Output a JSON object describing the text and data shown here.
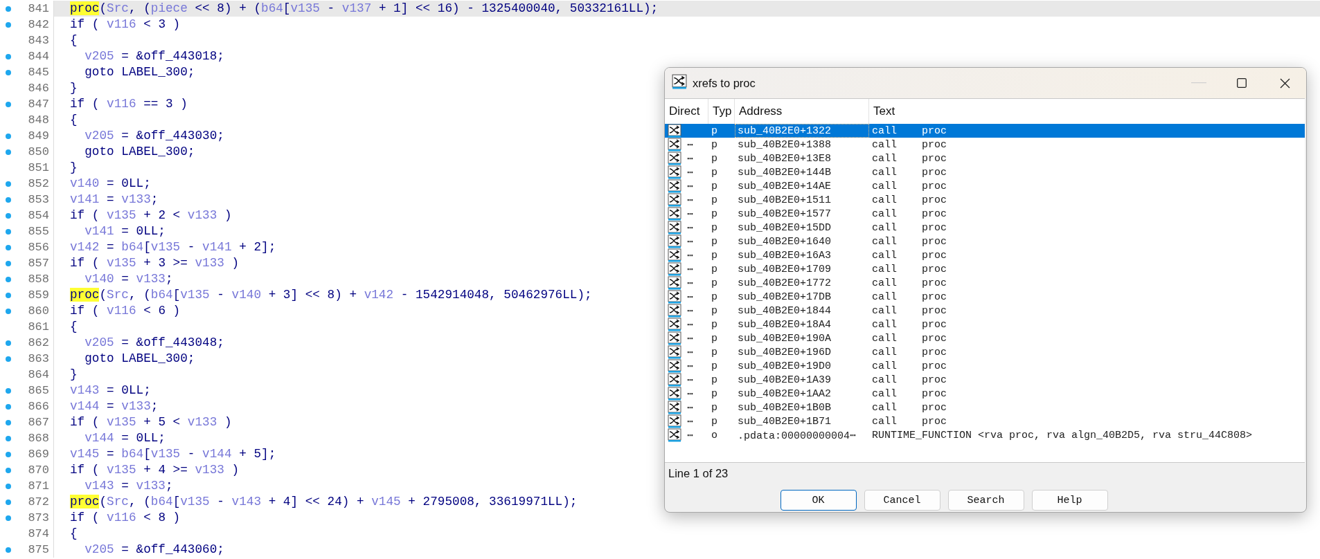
{
  "code": {
    "lines": [
      {
        "number": "841",
        "dot": true,
        "current": true,
        "tokens": [
          {
            "kind": "hit",
            "text": "proc"
          },
          "(",
          {
            "kind": "var",
            "text": "Src"
          },
          ", (",
          {
            "kind": "var",
            "text": "piece"
          },
          " << 8) + (",
          {
            "kind": "var",
            "text": "b64"
          },
          "[",
          {
            "kind": "var",
            "text": "v135"
          },
          " - ",
          {
            "kind": "var",
            "text": "v137"
          },
          " + 1] << 16) - 1325400040, 50332161LL);"
        ]
      },
      {
        "number": "842",
        "dot": true,
        "current": false,
        "tokens": [
          "if ( ",
          {
            "kind": "var",
            "text": "v116"
          },
          " < 3 )"
        ]
      },
      {
        "number": "843",
        "dot": false,
        "current": false,
        "tokens": [
          "{"
        ]
      },
      {
        "number": "844",
        "dot": true,
        "current": false,
        "tokens": [
          {
            "kind": "var",
            "text": "  v205"
          },
          " = &off_443018;"
        ]
      },
      {
        "number": "845",
        "dot": true,
        "current": false,
        "tokens": [
          "  goto LABEL_300;"
        ]
      },
      {
        "number": "846",
        "dot": false,
        "current": false,
        "tokens": [
          "}"
        ]
      },
      {
        "number": "847",
        "dot": true,
        "current": false,
        "tokens": [
          "if ( ",
          {
            "kind": "var",
            "text": "v116"
          },
          " == 3 )"
        ]
      },
      {
        "number": "848",
        "dot": false,
        "current": false,
        "tokens": [
          "{"
        ]
      },
      {
        "number": "849",
        "dot": true,
        "current": false,
        "tokens": [
          {
            "kind": "var",
            "text": "  v205"
          },
          " = &off_443030;"
        ]
      },
      {
        "number": "850",
        "dot": true,
        "current": false,
        "tokens": [
          "  goto LABEL_300;"
        ]
      },
      {
        "number": "851",
        "dot": false,
        "current": false,
        "tokens": [
          "}"
        ]
      },
      {
        "number": "852",
        "dot": true,
        "current": false,
        "tokens": [
          {
            "kind": "var",
            "text": "v140"
          },
          " = 0LL;"
        ]
      },
      {
        "number": "853",
        "dot": true,
        "current": false,
        "tokens": [
          {
            "kind": "var",
            "text": "v141"
          },
          " = ",
          {
            "kind": "var",
            "text": "v133"
          },
          ";"
        ]
      },
      {
        "number": "854",
        "dot": true,
        "current": false,
        "tokens": [
          "if ( ",
          {
            "kind": "var",
            "text": "v135"
          },
          " + 2 < ",
          {
            "kind": "var",
            "text": "v133"
          },
          " )"
        ]
      },
      {
        "number": "855",
        "dot": true,
        "current": false,
        "tokens": [
          {
            "kind": "var",
            "text": "  v141"
          },
          " = 0LL;"
        ]
      },
      {
        "number": "856",
        "dot": true,
        "current": false,
        "tokens": [
          {
            "kind": "var",
            "text": "v142"
          },
          " = ",
          {
            "kind": "var",
            "text": "b64"
          },
          "[",
          {
            "kind": "var",
            "text": "v135"
          },
          " - ",
          {
            "kind": "var",
            "text": "v141"
          },
          " + 2];"
        ]
      },
      {
        "number": "857",
        "dot": true,
        "current": false,
        "tokens": [
          "if ( ",
          {
            "kind": "var",
            "text": "v135"
          },
          " + 3 >= ",
          {
            "kind": "var",
            "text": "v133"
          },
          " )"
        ]
      },
      {
        "number": "858",
        "dot": true,
        "current": false,
        "tokens": [
          {
            "kind": "var",
            "text": "  v140"
          },
          " = ",
          {
            "kind": "var",
            "text": "v133"
          },
          ";"
        ]
      },
      {
        "number": "859",
        "dot": true,
        "current": false,
        "tokens": [
          {
            "kind": "hit",
            "text": "proc"
          },
          "(",
          {
            "kind": "var",
            "text": "Src"
          },
          ", (",
          {
            "kind": "var",
            "text": "b64"
          },
          "[",
          {
            "kind": "var",
            "text": "v135"
          },
          " - ",
          {
            "kind": "var",
            "text": "v140"
          },
          " + 3] << 8) + ",
          {
            "kind": "var",
            "text": "v142"
          },
          " - 1542914048, 50462976LL);"
        ]
      },
      {
        "number": "860",
        "dot": true,
        "current": false,
        "tokens": [
          "if ( ",
          {
            "kind": "var",
            "text": "v116"
          },
          " < 6 )"
        ]
      },
      {
        "number": "861",
        "dot": false,
        "current": false,
        "tokens": [
          "{"
        ]
      },
      {
        "number": "862",
        "dot": true,
        "current": false,
        "tokens": [
          {
            "kind": "var",
            "text": "  v205"
          },
          " = &off_443048;"
        ]
      },
      {
        "number": "863",
        "dot": true,
        "current": false,
        "tokens": [
          "  goto LABEL_300;"
        ]
      },
      {
        "number": "864",
        "dot": false,
        "current": false,
        "tokens": [
          "}"
        ]
      },
      {
        "number": "865",
        "dot": true,
        "current": false,
        "tokens": [
          {
            "kind": "var",
            "text": "v143"
          },
          " = 0LL;"
        ]
      },
      {
        "number": "866",
        "dot": true,
        "current": false,
        "tokens": [
          {
            "kind": "var",
            "text": "v144"
          },
          " = ",
          {
            "kind": "var",
            "text": "v133"
          },
          ";"
        ]
      },
      {
        "number": "867",
        "dot": true,
        "current": false,
        "tokens": [
          "if ( ",
          {
            "kind": "var",
            "text": "v135"
          },
          " + 5 < ",
          {
            "kind": "var",
            "text": "v133"
          },
          " )"
        ]
      },
      {
        "number": "868",
        "dot": true,
        "current": false,
        "tokens": [
          {
            "kind": "var",
            "text": "  v144"
          },
          " = 0LL;"
        ]
      },
      {
        "number": "869",
        "dot": true,
        "current": false,
        "tokens": [
          {
            "kind": "var",
            "text": "v145"
          },
          " = ",
          {
            "kind": "var",
            "text": "b64"
          },
          "[",
          {
            "kind": "var",
            "text": "v135"
          },
          " - ",
          {
            "kind": "var",
            "text": "v144"
          },
          " + 5];"
        ]
      },
      {
        "number": "870",
        "dot": true,
        "current": false,
        "tokens": [
          "if ( ",
          {
            "kind": "var",
            "text": "v135"
          },
          " + 4 >= ",
          {
            "kind": "var",
            "text": "v133"
          },
          " )"
        ]
      },
      {
        "number": "871",
        "dot": true,
        "current": false,
        "tokens": [
          {
            "kind": "var",
            "text": "  v143"
          },
          " = ",
          {
            "kind": "var",
            "text": "v133"
          },
          ";"
        ]
      },
      {
        "number": "872",
        "dot": true,
        "current": false,
        "tokens": [
          {
            "kind": "hit",
            "text": "proc"
          },
          "(",
          {
            "kind": "var",
            "text": "Src"
          },
          ", (",
          {
            "kind": "var",
            "text": "b64"
          },
          "[",
          {
            "kind": "var",
            "text": "v135"
          },
          " - ",
          {
            "kind": "var",
            "text": "v143"
          },
          " + 4] << 24) + ",
          {
            "kind": "var",
            "text": "v145"
          },
          " + 2795008, 33619971LL);"
        ]
      },
      {
        "number": "873",
        "dot": true,
        "current": false,
        "tokens": [
          "if ( ",
          {
            "kind": "var",
            "text": "v116"
          },
          " < 8 )"
        ]
      },
      {
        "number": "874",
        "dot": false,
        "current": false,
        "tokens": [
          "{"
        ]
      },
      {
        "number": "875",
        "dot": true,
        "current": false,
        "tokens": [
          {
            "kind": "var",
            "text": "  v205"
          },
          " = &off_443060;"
        ]
      }
    ]
  },
  "dialog": {
    "title": "xrefs to proc",
    "columns": [
      "Direct",
      "Typ",
      "Address",
      "Text"
    ],
    "rows": [
      {
        "selected": true,
        "type": "p",
        "address": "sub_40B2E0+1322",
        "text": "call    proc"
      },
      {
        "selected": false,
        "direction": "⋯",
        "type": "p",
        "address": "sub_40B2E0+1388",
        "text": "call    proc"
      },
      {
        "selected": false,
        "direction": "⋯",
        "type": "p",
        "address": "sub_40B2E0+13E8",
        "text": "call    proc"
      },
      {
        "selected": false,
        "direction": "⋯",
        "type": "p",
        "address": "sub_40B2E0+144B",
        "text": "call    proc"
      },
      {
        "selected": false,
        "direction": "⋯",
        "type": "p",
        "address": "sub_40B2E0+14AE",
        "text": "call    proc"
      },
      {
        "selected": false,
        "direction": "⋯",
        "type": "p",
        "address": "sub_40B2E0+1511",
        "text": "call    proc"
      },
      {
        "selected": false,
        "direction": "⋯",
        "type": "p",
        "address": "sub_40B2E0+1577",
        "text": "call    proc"
      },
      {
        "selected": false,
        "direction": "⋯",
        "type": "p",
        "address": "sub_40B2E0+15DD",
        "text": "call    proc"
      },
      {
        "selected": false,
        "direction": "⋯",
        "type": "p",
        "address": "sub_40B2E0+1640",
        "text": "call    proc"
      },
      {
        "selected": false,
        "direction": "⋯",
        "type": "p",
        "address": "sub_40B2E0+16A3",
        "text": "call    proc"
      },
      {
        "selected": false,
        "direction": "⋯",
        "type": "p",
        "address": "sub_40B2E0+1709",
        "text": "call    proc"
      },
      {
        "selected": false,
        "direction": "⋯",
        "type": "p",
        "address": "sub_40B2E0+1772",
        "text": "call    proc"
      },
      {
        "selected": false,
        "direction": "⋯",
        "type": "p",
        "address": "sub_40B2E0+17DB",
        "text": "call    proc"
      },
      {
        "selected": false,
        "direction": "⋯",
        "type": "p",
        "address": "sub_40B2E0+1844",
        "text": "call    proc"
      },
      {
        "selected": false,
        "direction": "⋯",
        "type": "p",
        "address": "sub_40B2E0+18A4",
        "text": "call    proc"
      },
      {
        "selected": false,
        "direction": "⋯",
        "type": "p",
        "address": "sub_40B2E0+190A",
        "text": "call    proc"
      },
      {
        "selected": false,
        "direction": "⋯",
        "type": "p",
        "address": "sub_40B2E0+196D",
        "text": "call    proc"
      },
      {
        "selected": false,
        "direction": "⋯",
        "type": "p",
        "address": "sub_40B2E0+19D0",
        "text": "call    proc"
      },
      {
        "selected": false,
        "direction": "⋯",
        "type": "p",
        "address": "sub_40B2E0+1A39",
        "text": "call    proc"
      },
      {
        "selected": false,
        "direction": "⋯",
        "type": "p",
        "address": "sub_40B2E0+1AA2",
        "text": "call    proc"
      },
      {
        "selected": false,
        "direction": "⋯",
        "type": "p",
        "address": "sub_40B2E0+1B0B",
        "text": "call    proc"
      },
      {
        "selected": false,
        "direction": "⋯",
        "type": "p",
        "address": "sub_40B2E0+1B71",
        "text": "call    proc"
      },
      {
        "selected": false,
        "direction": "⋯",
        "type": "o",
        "address": ".pdata:00000000004⋯",
        "text": "RUNTIME_FUNCTION <rva proc, rva algn_40B2D5, rva stru_44C808>"
      }
    ],
    "status": "Line 1 of 23",
    "buttons": [
      {
        "label": "OK",
        "default": true
      },
      {
        "label": "Cancel",
        "default": false
      },
      {
        "label": "Search",
        "default": false
      },
      {
        "label": "Help",
        "default": false
      }
    ]
  }
}
